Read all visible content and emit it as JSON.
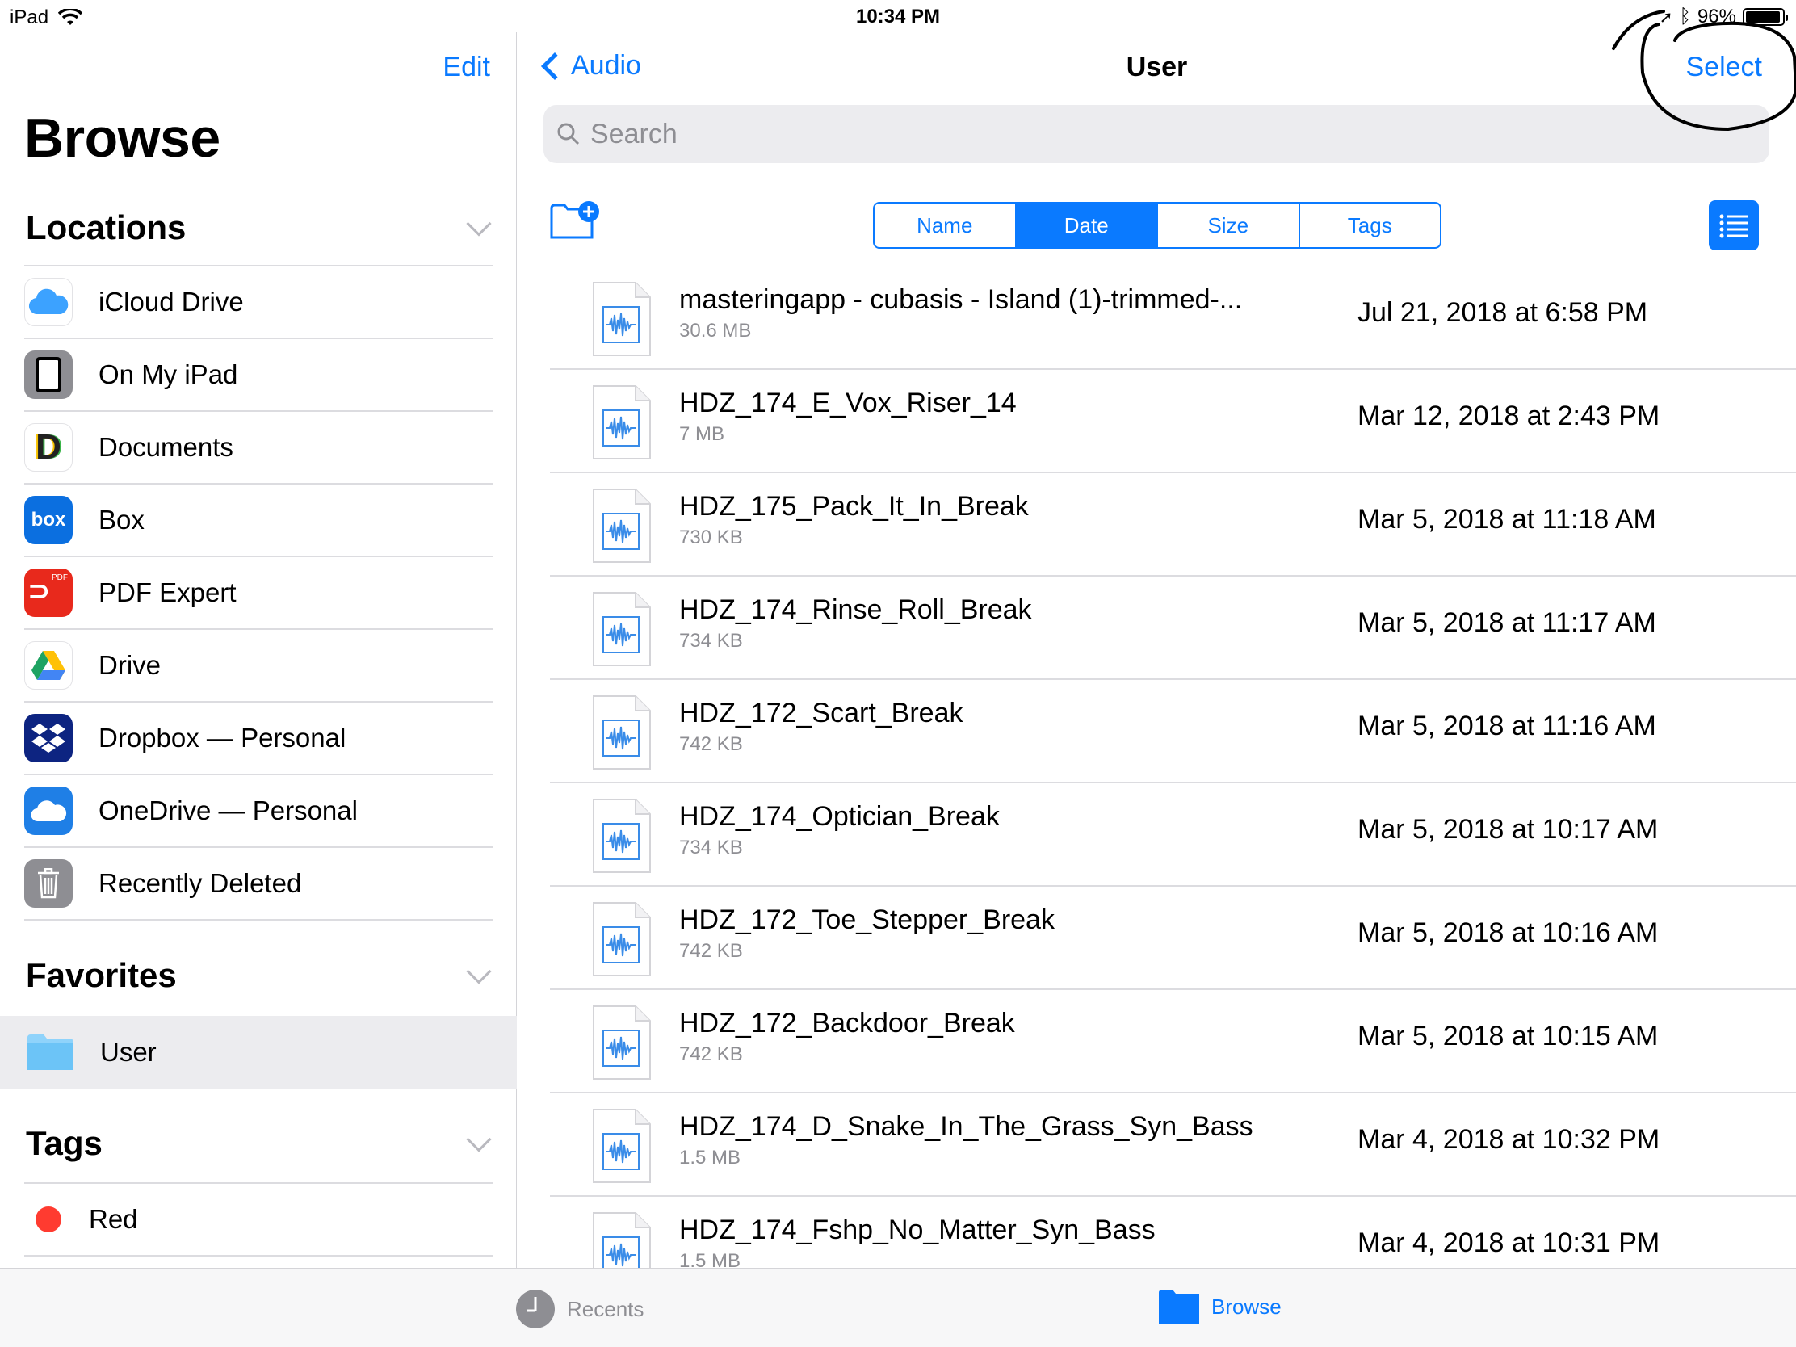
{
  "status": {
    "device": "iPad",
    "time": "10:34 PM",
    "battery": "96%"
  },
  "sidebar": {
    "edit_label": "Edit",
    "title": "Browse",
    "locations_label": "Locations",
    "locations": [
      {
        "label": "iCloud Drive",
        "icon": "icloud-icon"
      },
      {
        "label": "On My iPad",
        "icon": "ipad-icon"
      },
      {
        "label": "Documents",
        "icon": "documents-icon"
      },
      {
        "label": "Box",
        "icon": "box-icon",
        "icon_text": "box"
      },
      {
        "label": "PDF Expert",
        "icon": "pdf-expert-icon",
        "icon_text": "PDF"
      },
      {
        "label": "Drive",
        "icon": "google-drive-icon"
      },
      {
        "label": "Dropbox — Personal",
        "icon": "dropbox-icon"
      },
      {
        "label": "OneDrive — Personal",
        "icon": "onedrive-icon"
      },
      {
        "label": "Recently Deleted",
        "icon": "trash-icon"
      }
    ],
    "favorites_label": "Favorites",
    "favorites": [
      {
        "label": "User",
        "icon": "folder-icon"
      }
    ],
    "tags_label": "Tags",
    "tags": [
      {
        "label": "Red",
        "color": "#ff3b30"
      }
    ]
  },
  "main": {
    "back_label": "Audio",
    "title": "User",
    "select_label": "Select",
    "search_placeholder": "Search",
    "sort_options": [
      "Name",
      "Date",
      "Size",
      "Tags"
    ],
    "active_sort": "Date",
    "files": [
      {
        "name": "masteringapp - cubasis - Island (1)-trimmed-...",
        "size": "30.6 MB",
        "date": "Jul 21, 2018 at 6:58 PM"
      },
      {
        "name": "HDZ_174_E_Vox_Riser_14",
        "size": "7 MB",
        "date": "Mar 12, 2018 at 2:43 PM"
      },
      {
        "name": "HDZ_175_Pack_It_In_Break",
        "size": "730 KB",
        "date": "Mar 5, 2018 at 11:18 AM"
      },
      {
        "name": "HDZ_174_Rinse_Roll_Break",
        "size": "734 KB",
        "date": "Mar 5, 2018 at 11:17 AM"
      },
      {
        "name": "HDZ_172_Scart_Break",
        "size": "742 KB",
        "date": "Mar 5, 2018 at 11:16 AM"
      },
      {
        "name": "HDZ_174_Optician_Break",
        "size": "734 KB",
        "date": "Mar 5, 2018 at 10:17 AM"
      },
      {
        "name": "HDZ_172_Toe_Stepper_Break",
        "size": "742 KB",
        "date": "Mar 5, 2018 at 10:16 AM"
      },
      {
        "name": "HDZ_172_Backdoor_Break",
        "size": "742 KB",
        "date": "Mar 5, 2018 at 10:15 AM"
      },
      {
        "name": "HDZ_174_D_Snake_In_The_Grass_Syn_Bass",
        "size": "1.5 MB",
        "date": "Mar 4, 2018 at 10:32 PM"
      },
      {
        "name": "HDZ_174_Fshp_No_Matter_Syn_Bass",
        "size": "1.5 MB",
        "date": "Mar 4, 2018 at 10:31 PM"
      }
    ]
  },
  "tabbar": {
    "recents_label": "Recents",
    "browse_label": "Browse",
    "active": "Browse"
  },
  "colors": {
    "accent": "#0a7aff",
    "secondary_text": "#8e8e93",
    "separator": "#dcdce0"
  }
}
